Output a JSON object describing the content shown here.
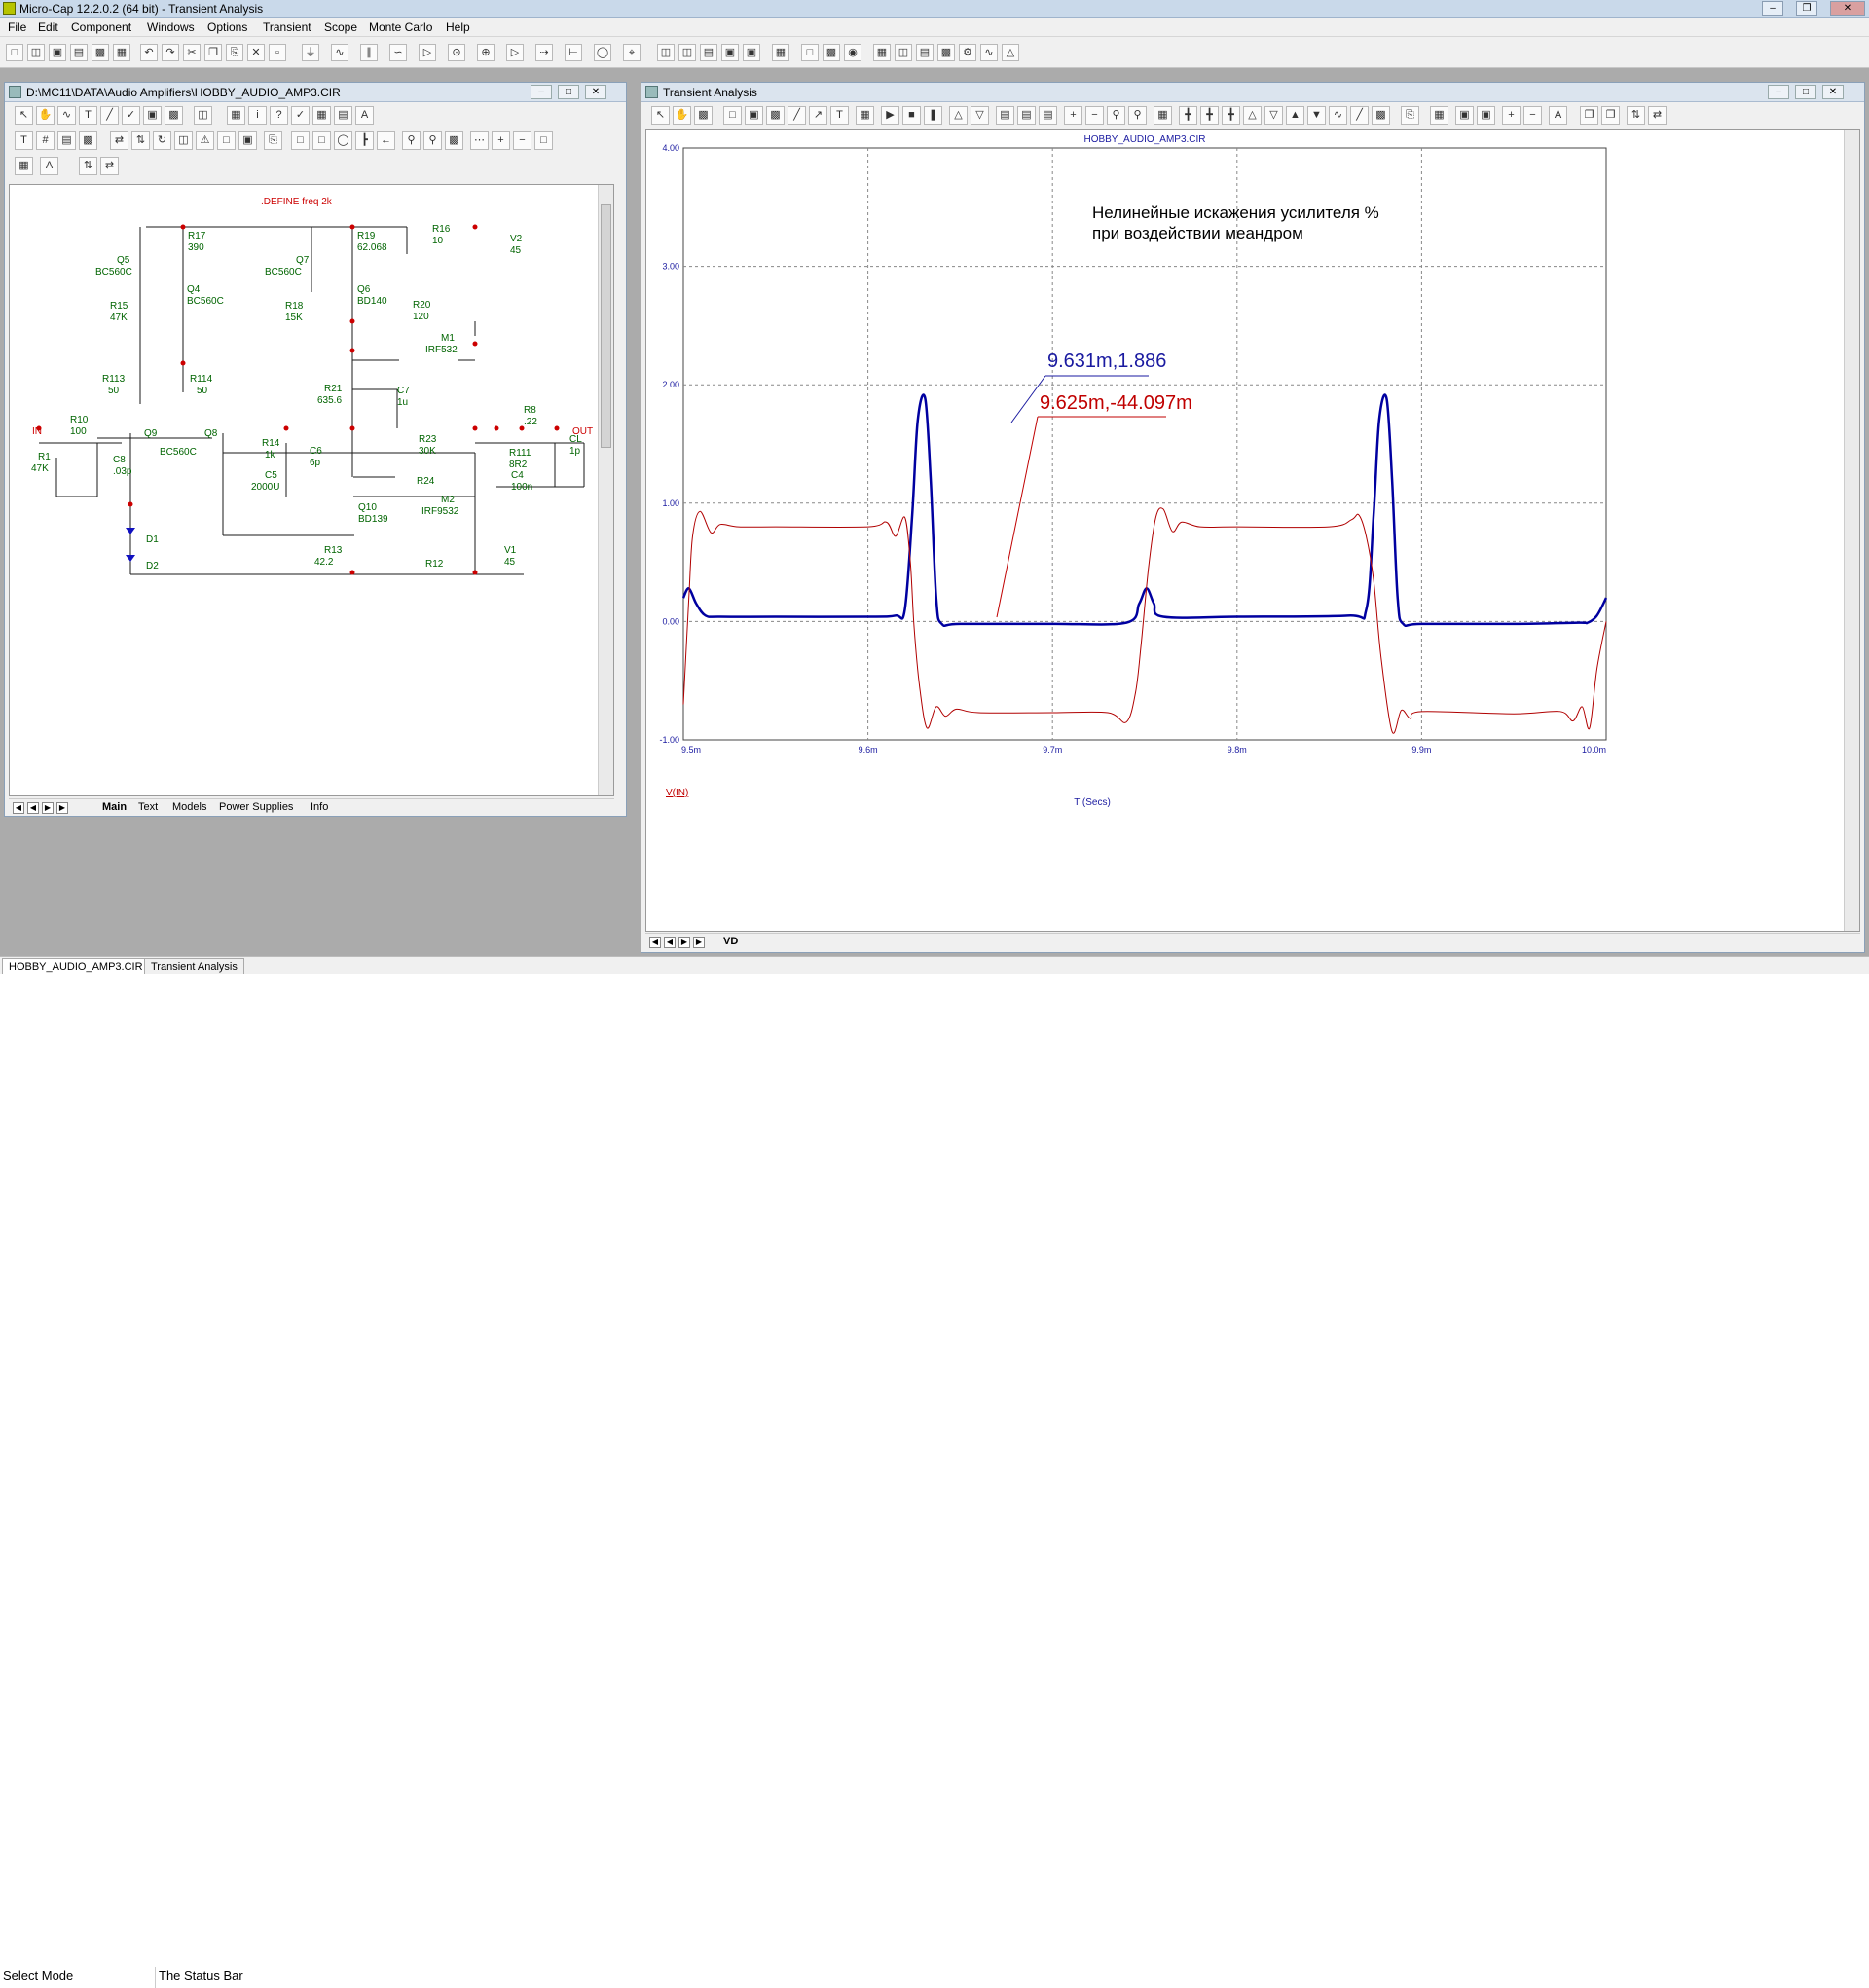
{
  "app": {
    "title": "Micro-Cap 12.2.0.2 (64 bit) - Transient Analysis"
  },
  "menu": [
    "File",
    "Edit",
    "Component",
    "Windows",
    "Options",
    "Transient",
    "Scope",
    "Monte Carlo",
    "Help"
  ],
  "schematic": {
    "title": "D:\\MC11\\DATA\\Audio Amplifiers\\HOBBY_AUDIO_AMP3.CIR",
    "define": ".DEFINE freq 2k",
    "tabs": [
      "Main",
      "Text",
      "Models",
      "Power Supplies",
      "Info"
    ],
    "labels": [
      {
        "id": "q5",
        "text": "Q5"
      },
      {
        "id": "q5m",
        "text": "BC560C"
      },
      {
        "id": "r17",
        "text": "R17"
      },
      {
        "id": "r17v",
        "text": "390"
      },
      {
        "id": "q4",
        "text": "Q4"
      },
      {
        "id": "q4m",
        "text": "BC560C"
      },
      {
        "id": "r15",
        "text": "R15"
      },
      {
        "id": "r15v",
        "text": "47K"
      },
      {
        "id": "q7",
        "text": "Q7"
      },
      {
        "id": "q7m",
        "text": "BC560C"
      },
      {
        "id": "r19",
        "text": "R19"
      },
      {
        "id": "r19v",
        "text": "62.068"
      },
      {
        "id": "r16",
        "text": "R16"
      },
      {
        "id": "r16v",
        "text": "10"
      },
      {
        "id": "v2",
        "text": "V2"
      },
      {
        "id": "v2v",
        "text": "45"
      },
      {
        "id": "q6",
        "text": "Q6"
      },
      {
        "id": "q6m",
        "text": "BD140"
      },
      {
        "id": "r18",
        "text": "R18"
      },
      {
        "id": "r18v",
        "text": "15K"
      },
      {
        "id": "r20",
        "text": "R20"
      },
      {
        "id": "r20v",
        "text": "120"
      },
      {
        "id": "m1",
        "text": "M1"
      },
      {
        "id": "m1m",
        "text": "IRF532"
      },
      {
        "id": "r113",
        "text": "R113"
      },
      {
        "id": "r113v",
        "text": "50"
      },
      {
        "id": "r114",
        "text": "R114"
      },
      {
        "id": "r114v",
        "text": "50"
      },
      {
        "id": "r21",
        "text": "R21"
      },
      {
        "id": "r21v",
        "text": "635.6"
      },
      {
        "id": "c7",
        "text": "C7"
      },
      {
        "id": "c7v",
        "text": "1u"
      },
      {
        "id": "in",
        "text": "IN"
      },
      {
        "id": "r10",
        "text": "R10"
      },
      {
        "id": "r10v",
        "text": "100"
      },
      {
        "id": "q9",
        "text": "Q9"
      },
      {
        "id": "q8",
        "text": "Q8"
      },
      {
        "id": "q98m",
        "text": "BC560C"
      },
      {
        "id": "r8",
        "text": "R8"
      },
      {
        "id": "r8v",
        "text": ".22"
      },
      {
        "id": "out",
        "text": "OUT"
      },
      {
        "id": "r1",
        "text": "R1"
      },
      {
        "id": "r1v",
        "text": "47K"
      },
      {
        "id": "c8",
        "text": "C8"
      },
      {
        "id": "c8v",
        "text": ".03p"
      },
      {
        "id": "r14",
        "text": "R14"
      },
      {
        "id": "r14v",
        "text": "1k"
      },
      {
        "id": "c6",
        "text": "C6"
      },
      {
        "id": "c6v",
        "text": "6p"
      },
      {
        "id": "r23",
        "text": "R23"
      },
      {
        "id": "r23v",
        "text": "30K"
      },
      {
        "id": "r111",
        "text": "R111"
      },
      {
        "id": "r111v",
        "text": "8R2"
      },
      {
        "id": "cl",
        "text": "CL"
      },
      {
        "id": "clv",
        "text": "1p"
      },
      {
        "id": "rl",
        "text": "RL"
      },
      {
        "id": "rlv",
        "text": "8"
      },
      {
        "id": "c5",
        "text": "C5"
      },
      {
        "id": "c5v",
        "text": "2000U"
      },
      {
        "id": "r24",
        "text": "R24"
      },
      {
        "id": "c4",
        "text": "C4"
      },
      {
        "id": "c4v",
        "text": "100n"
      },
      {
        "id": "m2",
        "text": "M2"
      },
      {
        "id": "m2m",
        "text": "IRF9532"
      },
      {
        "id": "q10",
        "text": "Q10"
      },
      {
        "id": "q10m",
        "text": "BD139"
      },
      {
        "id": "d1",
        "text": "D1"
      },
      {
        "id": "d2",
        "text": "D2"
      },
      {
        "id": "r13",
        "text": "R13"
      },
      {
        "id": "r13v",
        "text": "42.2"
      },
      {
        "id": "r12",
        "text": "R12"
      },
      {
        "id": "v1",
        "text": "V1"
      },
      {
        "id": "v1v",
        "text": "45"
      }
    ]
  },
  "analysis": {
    "title": "Transient Analysis",
    "plot_title": "HOBBY_AUDIO_AMP3.CIR",
    "annotation_line1": "Нелинейные искажения усилителя %",
    "annotation_line2": "при воздействии меандром",
    "label_blue": "9.631m,1.886",
    "label_red": "9.625m,-44.097m",
    "ylabel_series": "V(IN)",
    "xlabel": "T (Secs)",
    "tabs": [
      "VD"
    ]
  },
  "chart_data": {
    "type": "line",
    "title": "HOBBY_AUDIO_AMP3.CIR",
    "xlabel": "T (Secs)",
    "ylabel": "V(IN)",
    "xlim": [
      9.5,
      10.0
    ],
    "ylim": [
      -1.0,
      4.0
    ],
    "x_ticks": [
      "9.5m",
      "9.6m",
      "9.7m",
      "9.8m",
      "9.9m",
      "10.0m"
    ],
    "y_ticks": [
      "-1.00",
      "0.00",
      "1.00",
      "2.00",
      "3.00",
      "4.00"
    ],
    "grid": true,
    "series": [
      {
        "name": "",
        "color": "#0000a0",
        "x": [
          9.5,
          9.503,
          9.507,
          9.512,
          9.52,
          9.55,
          9.6,
          9.615,
          9.62,
          9.624,
          9.627,
          9.631,
          9.634,
          9.637,
          9.64,
          9.65,
          9.7,
          9.74,
          9.747,
          9.751,
          9.755,
          9.76,
          9.8,
          9.86,
          9.87,
          9.874,
          9.877,
          9.881,
          9.884,
          9.887,
          9.89,
          9.9,
          9.95,
          9.985,
          9.99,
          9.995,
          10.0
        ],
        "y": [
          0.2,
          0.28,
          0.15,
          0.05,
          0.04,
          0.04,
          0.04,
          0.05,
          0.1,
          0.9,
          1.7,
          1.886,
          1.2,
          0.2,
          -0.02,
          -0.02,
          -0.02,
          -0.01,
          0.15,
          0.28,
          0.15,
          0.04,
          0.04,
          0.05,
          0.1,
          0.9,
          1.7,
          1.886,
          1.2,
          0.2,
          -0.02,
          -0.02,
          -0.02,
          -0.01,
          -0.01,
          0.05,
          0.2
        ]
      },
      {
        "name": "",
        "color": "#b00000",
        "x": [
          9.5,
          9.503,
          9.505,
          9.509,
          9.515,
          9.52,
          9.53,
          9.55,
          9.6,
          9.61,
          9.615,
          9.62,
          9.623,
          9.625,
          9.628,
          9.632,
          9.637,
          9.642,
          9.648,
          9.66,
          9.7,
          9.73,
          9.74,
          9.745,
          9.748,
          9.752,
          9.756,
          9.76,
          9.765,
          9.77,
          9.78,
          9.8,
          9.85,
          9.862,
          9.866,
          9.87,
          9.874,
          9.878,
          9.884,
          9.889,
          9.894,
          9.9,
          9.95,
          9.975,
          9.982,
          9.987,
          9.991,
          9.995,
          10.0
        ],
        "y": [
          -0.7,
          0.2,
          0.72,
          0.93,
          0.75,
          0.82,
          0.8,
          0.8,
          0.8,
          0.84,
          0.72,
          0.88,
          0.5,
          -0.044,
          -0.55,
          -0.9,
          -0.72,
          -0.8,
          -0.74,
          -0.77,
          -0.77,
          -0.77,
          -0.85,
          -0.6,
          -0.2,
          0.45,
          0.88,
          0.95,
          0.76,
          0.84,
          0.8,
          0.8,
          0.8,
          0.86,
          0.9,
          0.72,
          0.35,
          -0.3,
          -0.93,
          -0.75,
          -0.82,
          -0.76,
          -0.78,
          -0.76,
          -0.84,
          -0.72,
          -0.9,
          -0.4,
          0.0
        ]
      }
    ]
  }
}
